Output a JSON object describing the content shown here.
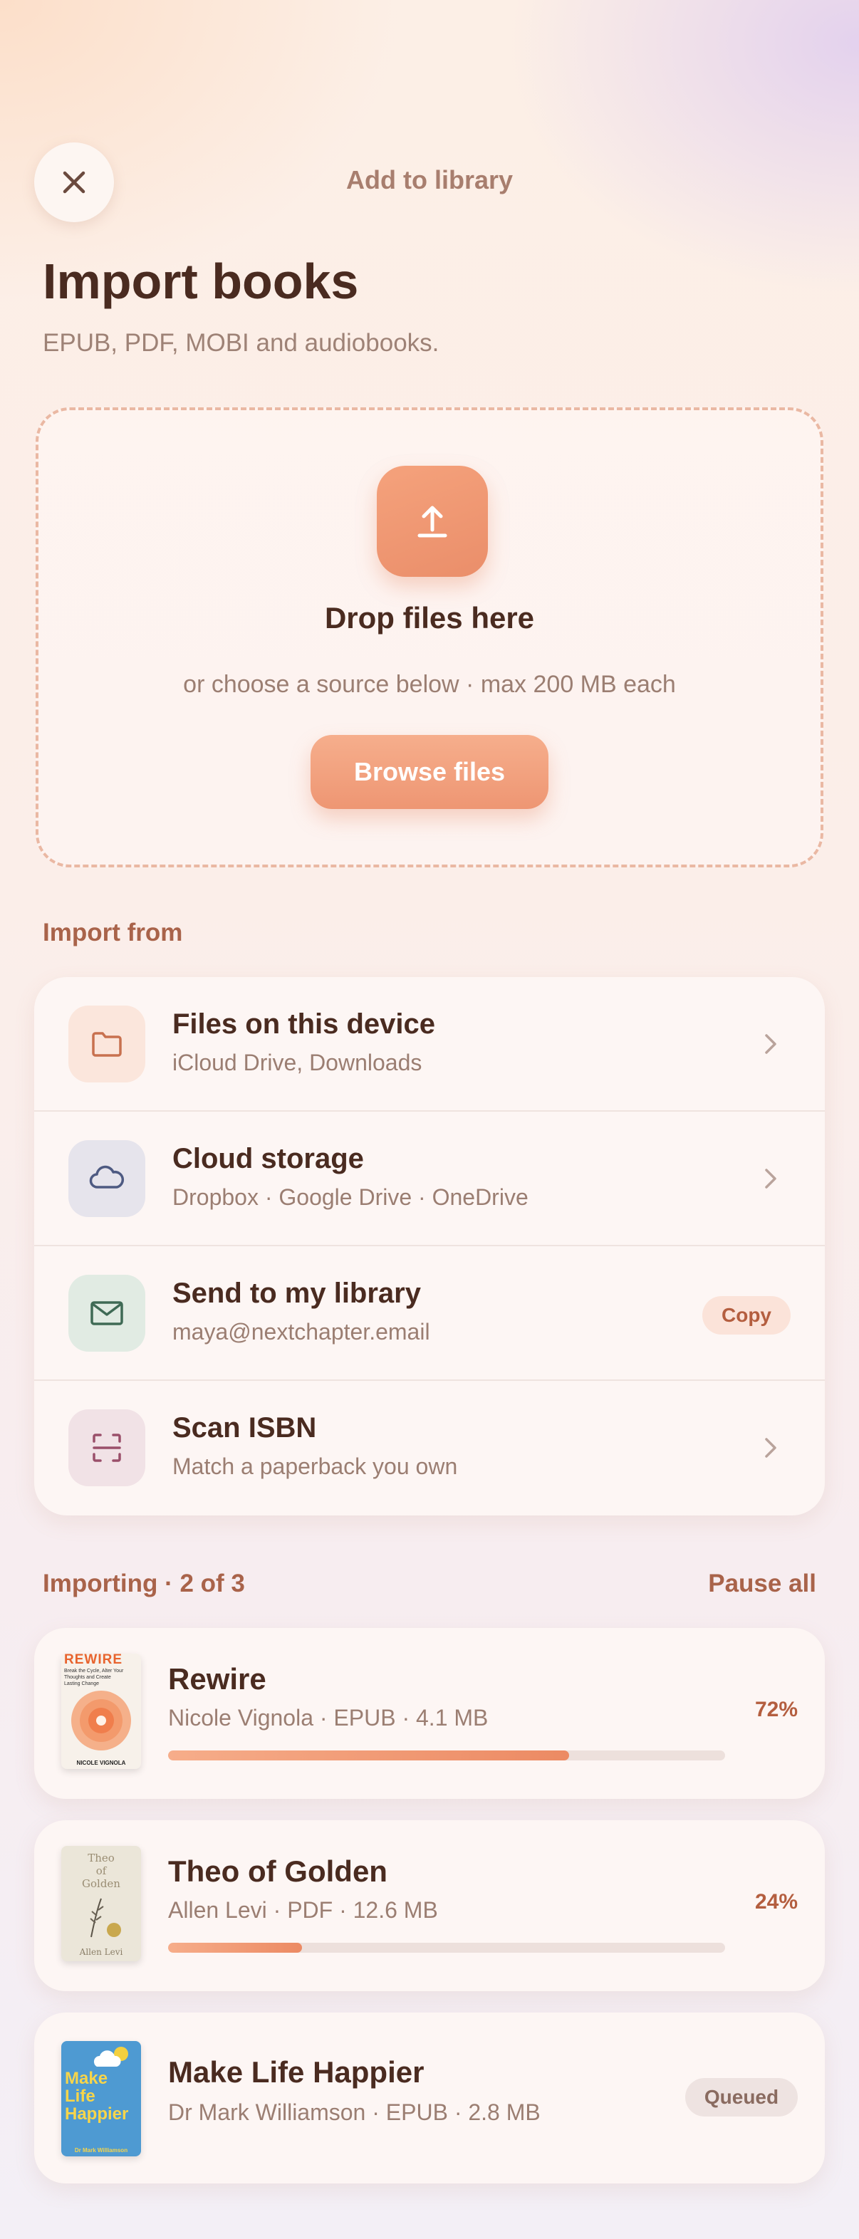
{
  "header": {
    "title": "Add to library",
    "close_icon": "close-icon"
  },
  "page": {
    "title": "Import books",
    "subtitle": "EPUB, PDF, MOBI and audiobooks."
  },
  "dropzone": {
    "icon": "upload-icon",
    "title": "Drop files here",
    "subtitle": "or choose a source below · max 200 MB each",
    "browse_label": "Browse files"
  },
  "import_from": {
    "label": "Import from",
    "sources": [
      {
        "title": "Files on this device",
        "subtitle": "iCloud Drive, Downloads",
        "icon": "folder-icon",
        "icon_bg": "#fbe6dc",
        "icon_color": "#c8714f",
        "action": "chevron"
      },
      {
        "title": "Cloud storage",
        "subtitle": "Dropbox · Google Drive · OneDrive",
        "icon": "cloud-icon",
        "icon_bg": "#e6e4ec",
        "icon_color": "#4e5a82",
        "action": "chevron"
      },
      {
        "title": "Send to my library",
        "subtitle": "maya@nextchapter.email",
        "icon": "mail-icon",
        "icon_bg": "#e1ebe3",
        "icon_color": "#3f6a55",
        "action": "copy",
        "action_label": "Copy"
      },
      {
        "title": "Scan ISBN",
        "subtitle": "Match a paperback you own",
        "icon": "scan-icon",
        "icon_bg": "#f1e2e6",
        "icon_color": "#9a4f6a",
        "action": "chevron"
      }
    ]
  },
  "importing": {
    "label": "Importing · 2 of 3",
    "pause_label": "Pause all",
    "items": [
      {
        "title": "Rewire",
        "meta": "Nicole Vignola · EPUB · 4.1 MB",
        "progress_pct": 72,
        "status": "72%",
        "cover": {
          "title": "REWIRE",
          "tagline": "Break the Cycle, Alter Your Thoughts and Create Lasting Change",
          "author": "NICOLE VIGNOLA"
        }
      },
      {
        "title": "Theo of Golden",
        "meta": "Allen Levi · PDF · 12.6 MB",
        "progress_pct": 24,
        "status": "24%",
        "cover": {
          "title_line1": "Theo",
          "title_line2": "of",
          "title_line3": "Golden",
          "author": "Allen Levi"
        }
      },
      {
        "title": "Make Life Happier",
        "meta": "Dr Mark Williamson · EPUB · 2.8 MB",
        "status": "Queued",
        "cover": {
          "line1": "Make",
          "line2": "Life",
          "line3": "Happier",
          "author": "Dr Mark Williamson"
        }
      }
    ]
  },
  "colors": {
    "accent": "#ec8a63",
    "text_primary": "#4a2b20",
    "text_secondary": "#9b7e72",
    "section_label": "#a9634a"
  }
}
